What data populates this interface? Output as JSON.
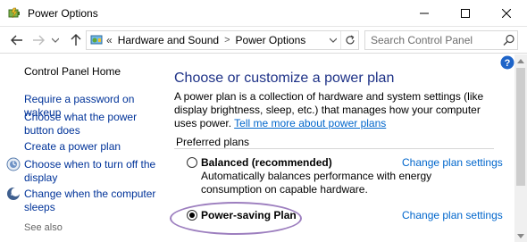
{
  "window": {
    "title": "Power Options"
  },
  "address_bar": {
    "prefix": "«",
    "crumbs": [
      "Hardware and Sound",
      "Power Options"
    ],
    "separator": ">"
  },
  "search": {
    "placeholder": "Search Control Panel"
  },
  "sidebar": {
    "home": "Control Panel Home",
    "items": [
      {
        "label": "Require a password on wakeup",
        "icon": "none"
      },
      {
        "label": "Choose what the power button does",
        "icon": "none"
      },
      {
        "label": "Create a power plan",
        "icon": "none"
      },
      {
        "label": "Choose when to turn off the display",
        "icon": "display-icon"
      },
      {
        "label": "Change when the computer sleeps",
        "icon": "moon-icon"
      },
      {
        "label": "See also",
        "icon": "none"
      }
    ]
  },
  "main": {
    "heading": "Choose or customize a power plan",
    "description": "A power plan is a collection of hardware and system settings (like display brightness, sleep, etc.) that manages how your computer uses power.",
    "description_link": "Tell me more about power plans",
    "section_label": "Preferred plans",
    "plans": [
      {
        "name": "Balanced (recommended)",
        "selected": false,
        "change_label": "Change plan settings",
        "description": "Automatically balances performance with energy consumption on capable hardware."
      },
      {
        "name": "Power-saving Plan",
        "selected": true,
        "change_label": "Change plan settings",
        "description": ""
      }
    ]
  },
  "colors": {
    "heading": "#1e3287",
    "link": "#0066cc",
    "sidebar_link": "#003399",
    "highlight": "#9d7fbf"
  }
}
